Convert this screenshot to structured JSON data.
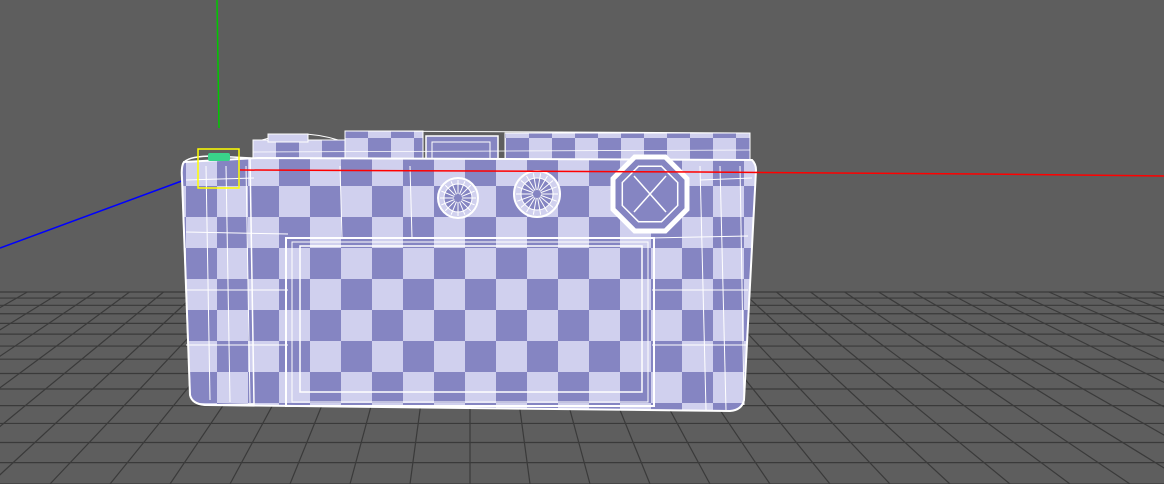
{
  "viewport": {
    "background_color": "#5e5e5e",
    "grid_color": "#3a3a3a",
    "axis_colors": {
      "x": "#ff0000",
      "y": "#00c800",
      "z": "#0000ff"
    },
    "gizmo_color": "#ffff00",
    "selected_vertex_color": "#39d48a",
    "wireframe_color": "#ffffff",
    "checker_colors": [
      "#8585c2",
      "#d0d0ee"
    ]
  },
  "model": {
    "name_icon": "camera-mesh-icon",
    "shading": "checker-texture",
    "display": "wireframe-on-shaded"
  }
}
